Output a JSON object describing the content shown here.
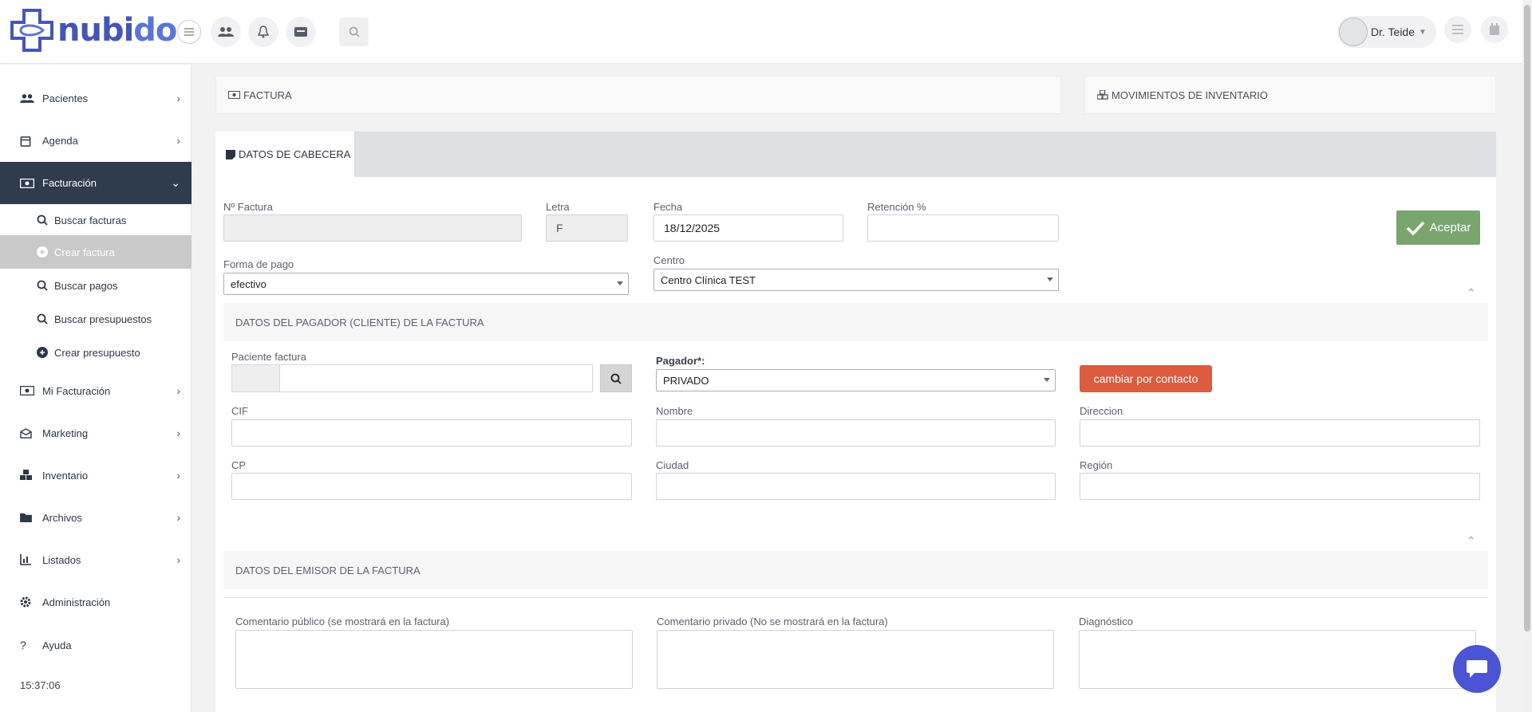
{
  "brand": {
    "part1": "nubi",
    "part2": "doc",
    "color1": "#4356b8",
    "color2": "#5b74d6"
  },
  "header": {
    "user_name": "Dr. Teide"
  },
  "sidebar": {
    "items": [
      {
        "label": "Pacientes",
        "icon": "users-icon"
      },
      {
        "label": "Agenda",
        "icon": "calendar-icon"
      },
      {
        "label": "Facturación",
        "icon": "money-icon",
        "active": true
      },
      {
        "label": "Mi Facturación",
        "icon": "money-icon"
      },
      {
        "label": "Marketing",
        "icon": "envelope-icon"
      },
      {
        "label": "Inventario",
        "icon": "cubes-icon"
      },
      {
        "label": "Archivos",
        "icon": "folder-icon"
      },
      {
        "label": "Listados",
        "icon": "chart-icon"
      },
      {
        "label": "Administración",
        "icon": "gear-icon"
      },
      {
        "label": "Ayuda",
        "icon": "question-icon"
      }
    ],
    "subitems": [
      {
        "label": "Buscar facturas",
        "icon": "search-icon"
      },
      {
        "label": "Crear factura",
        "icon": "plus-circle-icon",
        "current": true
      },
      {
        "label": "Buscar pagos",
        "icon": "search-icon"
      },
      {
        "label": "Buscar presupuestos",
        "icon": "search-icon"
      },
      {
        "label": "Crear presupuesto",
        "icon": "plus-circle-icon"
      }
    ],
    "clock": "15:37:06"
  },
  "panels": {
    "factura": "FACTURA",
    "movimientos": "MOVIMIENTOS DE INVENTARIO"
  },
  "tab": {
    "label": "DATOS DE CABECERA"
  },
  "form": {
    "num_factura_label": "Nº Factura",
    "num_factura_value": "",
    "letra_label": "Letra",
    "letra_value": "F",
    "fecha_label": "Fecha",
    "fecha_value": "18/12/2025",
    "retencion_label": "Retención %",
    "retencion_value": "",
    "aceptar_label": "Aceptar",
    "forma_pago_label": "Forma de pago",
    "forma_pago_value": "efectivo",
    "centro_label": "Centro",
    "centro_value": "Centro Clínica TEST"
  },
  "pagador": {
    "section_title": "DATOS DEL PAGADOR (CLIENTE) DE LA FACTURA",
    "paciente_label": "Paciente factura",
    "pagador_label": "Pagador*:",
    "pagador_value": "PRIVADO",
    "contact_button": "cambiar por contacto",
    "cif_label": "CIF",
    "nombre_label": "Nombre",
    "direccion_label": "Direccion",
    "cp_label": "CP",
    "ciudad_label": "Ciudad",
    "region_label": "Región"
  },
  "emisor": {
    "section_title": "DATOS DEL EMISOR DE LA FACTURA"
  },
  "comments": {
    "publico_label": "Comentario público (se mostrará en la factura)",
    "privado_label": "Comentario privado (No se mostrará en la factura)",
    "diagnostico_label": "Diagnóstico"
  },
  "colors": {
    "sidebar_active": "#2f3c4e",
    "accept": "#7aa56e",
    "contact": "#dd5b3e",
    "chat": "#4a54d4"
  }
}
